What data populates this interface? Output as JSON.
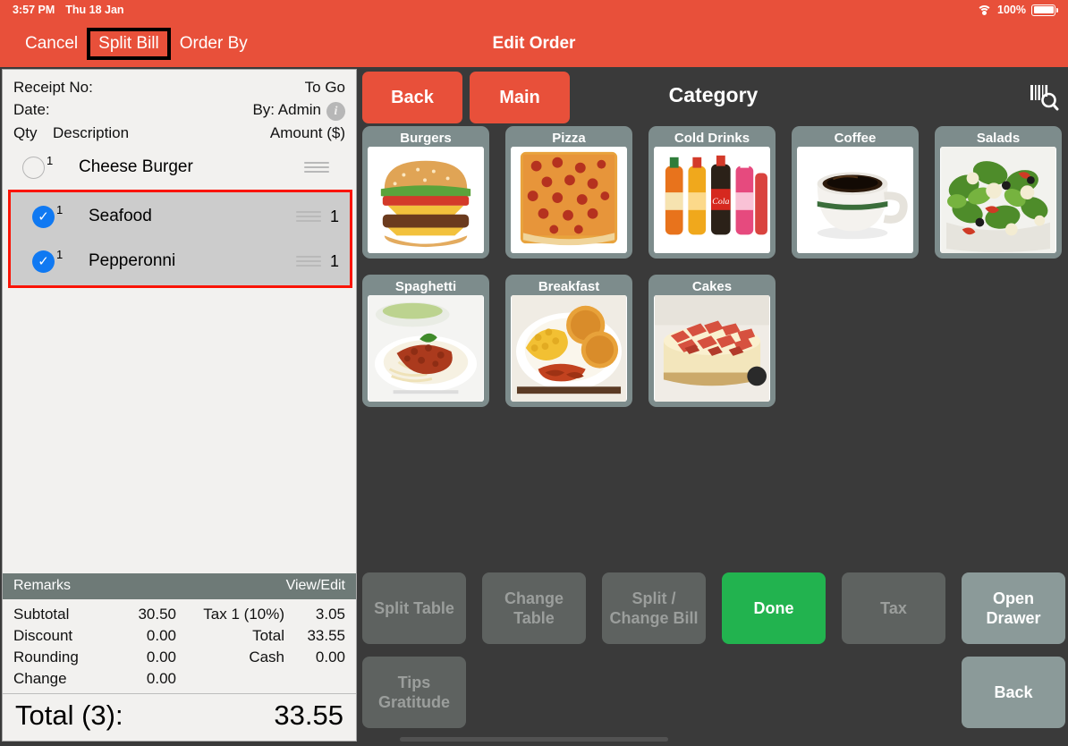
{
  "status_bar": {
    "time": "3:57 PM",
    "date": "Thu 18 Jan",
    "battery_percent": "100%",
    "wifi_icon": "wifi-icon",
    "battery_icon": "battery-icon"
  },
  "nav": {
    "cancel_label": "Cancel",
    "split_bill_label": "Split Bill",
    "order_by_label": "Order By",
    "title": "Edit Order"
  },
  "receipt": {
    "receipt_no_label": "Receipt No:",
    "receipt_no_value": "",
    "to_go_label": "To Go",
    "date_label": "Date:",
    "date_value": "",
    "by_label": "By: Admin",
    "info_icon": "info-icon",
    "col_qty": "Qty",
    "col_description": "Description",
    "col_amount": "Amount ($)",
    "items": [
      {
        "selected": false,
        "qty": "1",
        "name": "Cheese Burger",
        "amount": "",
        "handle_icon": "drag-handle-icon"
      },
      {
        "selected": true,
        "qty": "1",
        "name": "Seafood",
        "amount": "1",
        "handle_icon": "drag-handle-icon"
      },
      {
        "selected": true,
        "qty": "1",
        "name": "Pepperonni",
        "amount": "1",
        "handle_icon": "drag-handle-icon"
      }
    ],
    "remarks_label": "Remarks",
    "view_edit_label": "View/Edit",
    "totals": [
      {
        "l1": "Subtotal",
        "v1": "30.50",
        "l2": "Tax 1 (10%)",
        "v2": "3.05"
      },
      {
        "l1": "Discount",
        "v1": "0.00",
        "l2": "Total",
        "v2": "33.55"
      },
      {
        "l1": "Rounding",
        "v1": "0.00",
        "l2": "Cash",
        "v2": "0.00"
      },
      {
        "l1": "Change",
        "v1": "0.00",
        "l2": "",
        "v2": ""
      }
    ],
    "grand_total_label": "Total (3):",
    "grand_total_value": "33.55"
  },
  "category_panel": {
    "back_label": "Back",
    "main_label": "Main",
    "title": "Category",
    "scan_icon": "barcode-scan-search-icon",
    "tiles": [
      {
        "label": "Burgers",
        "image": "burger-image"
      },
      {
        "label": "Pizza",
        "image": "pizza-image"
      },
      {
        "label": "Cold Drinks",
        "image": "cold-drinks-image"
      },
      {
        "label": "Coffee",
        "image": "coffee-image"
      },
      {
        "label": "Salads",
        "image": "salad-image"
      },
      {
        "label": "Spaghetti",
        "image": "spaghetti-image"
      },
      {
        "label": "Breakfast",
        "image": "breakfast-image"
      },
      {
        "label": "Cakes",
        "image": "cake-image"
      }
    ]
  },
  "actions": {
    "row1": [
      {
        "label": "Split Table",
        "style": "disabled"
      },
      {
        "label": "Change\nTable",
        "style": "disabled"
      },
      {
        "label": "Split /\nChange Bill",
        "style": "disabled"
      },
      {
        "label": "Done",
        "style": "green"
      },
      {
        "label": "Tax",
        "style": "disabled"
      },
      {
        "label": "Open\nDrawer",
        "style": "light"
      }
    ],
    "row2": [
      {
        "label": "Tips\nGratitude",
        "style": "disabled"
      },
      {
        "label": "Back",
        "style": "light"
      }
    ]
  },
  "colors": {
    "brand_red": "#e8503a",
    "highlight_red": "#fa1405",
    "checkbox_blue": "#1079f2",
    "done_green": "#22b34f",
    "tile_gray": "#7d8c8c",
    "panel_dark": "#3a3a3a",
    "remarks_bar": "#6e7a77"
  }
}
